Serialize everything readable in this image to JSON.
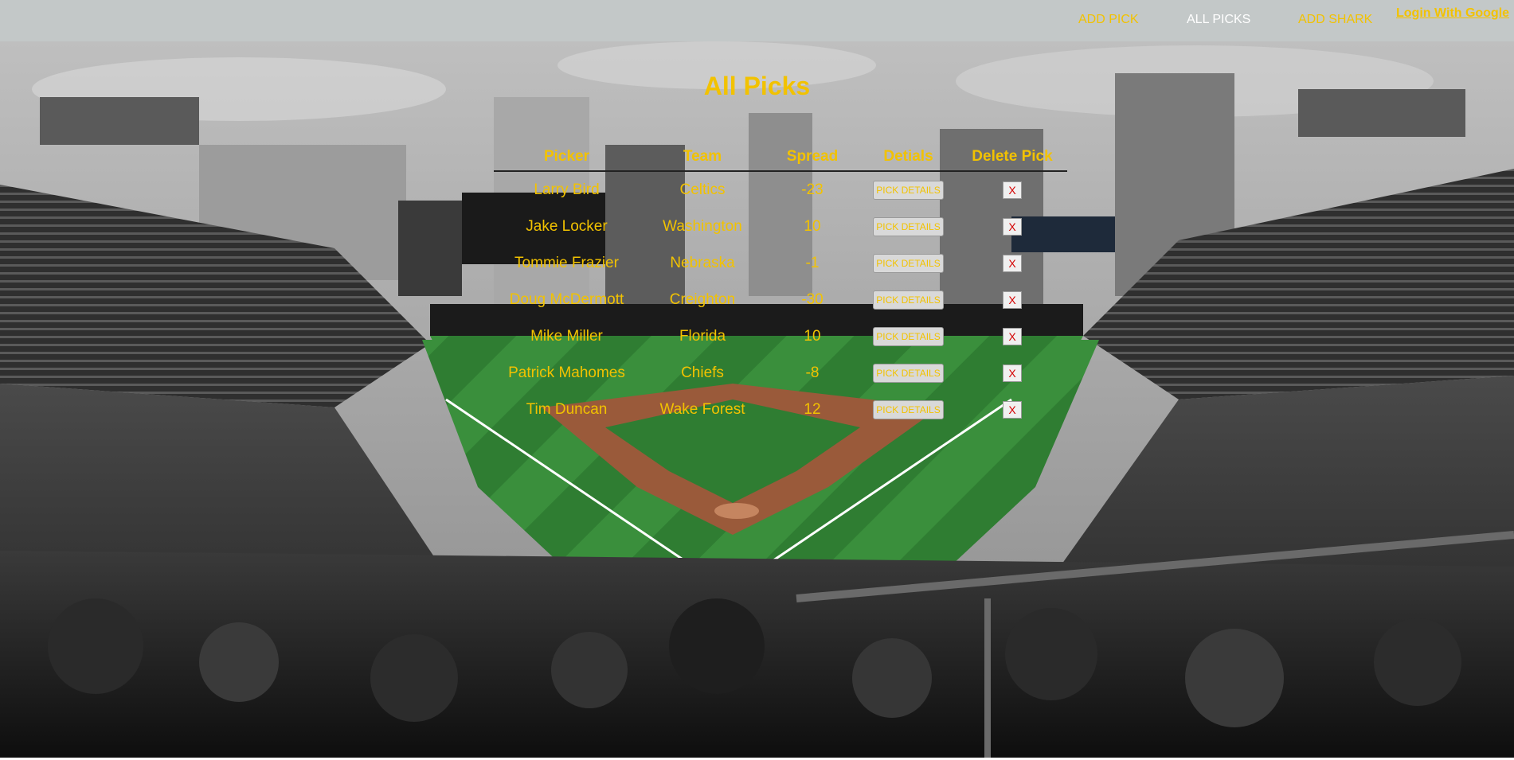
{
  "nav": {
    "add_pick": "ADD PICK",
    "all_picks": "ALL PICKS",
    "add_shark": "ADD SHARK",
    "login": "Login With Google"
  },
  "page": {
    "title": "All Picks"
  },
  "table": {
    "headers": [
      "Picker",
      "Team",
      "Spread",
      "Detials",
      "Delete Pick"
    ],
    "rows": [
      {
        "picker": "Larry Bird",
        "team": "Celtics",
        "spread": "-23",
        "details_label": "PICK DETAILS",
        "delete_label": "X"
      },
      {
        "picker": "Jake Locker",
        "team": "Washington",
        "spread": "10",
        "details_label": "PICK DETAILS",
        "delete_label": "X"
      },
      {
        "picker": "Tommie Frazier",
        "team": "Nebraska",
        "spread": "-1",
        "details_label": "PICK DETAILS",
        "delete_label": "X"
      },
      {
        "picker": "Doug McDermott",
        "team": "Creighton",
        "spread": "-30",
        "details_label": "PICK DETAILS",
        "delete_label": "X"
      },
      {
        "picker": "Mike Miller",
        "team": "Florida",
        "spread": "10",
        "details_label": "PICK DETAILS",
        "delete_label": "X"
      },
      {
        "picker": "Patrick Mahomes",
        "team": "Chiefs",
        "spread": "-8",
        "details_label": "PICK DETAILS",
        "delete_label": "X"
      },
      {
        "picker": "Tim Duncan",
        "team": "Wake Forest",
        "spread": "12",
        "details_label": "PICK DETAILS",
        "delete_label": "X"
      }
    ]
  },
  "colors": {
    "accent": "#f2c200",
    "navbar": "#c3c8c8",
    "active_nav": "#ffffff",
    "delete": "#d40000"
  }
}
